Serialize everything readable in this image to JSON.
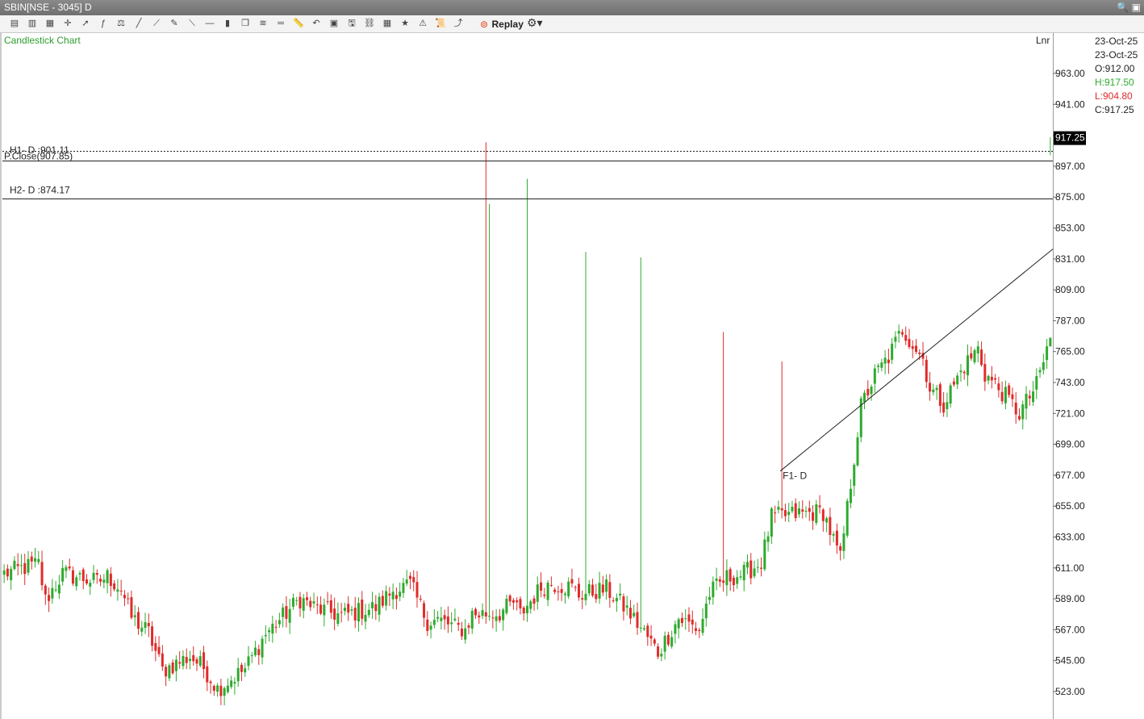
{
  "window": {
    "title": "SBIN[NSE - 3045] D"
  },
  "toolbar": {
    "icons": [
      "chart-type-icon",
      "bar-chart-icon",
      "candle-chart-icon",
      "crosshair-icon",
      "pointer-icon",
      "indicator-icon",
      "compare-icon",
      "line-tool-icon",
      "ray-icon",
      "pencil-icon",
      "trendline-icon",
      "horizontal-line-icon",
      "volume-icon",
      "cube-icon",
      "fibonacci-icon",
      "parallel-lines-icon",
      "ruler-icon",
      "undo-icon",
      "template-icon",
      "save-icon",
      "link-icon",
      "layout-icon",
      "star-icon",
      "alert-icon",
      "script-icon",
      "compare-line-icon"
    ],
    "replay_label": "Replay"
  },
  "chart": {
    "label": "Candlestick Chart",
    "scale_mode": "Lnr",
    "colors": {
      "up": "#2eaa2e",
      "down": "#e02b2b"
    }
  },
  "ohlc": {
    "date1": "23-Oct-25",
    "date2": "23-Oct-25",
    "open": "O:912.00",
    "high": "H:917.50",
    "low": "L:904.80",
    "close": "C:917.25",
    "colors": {
      "high": "#2eaa2e",
      "low": "#e02b2b"
    }
  },
  "last_price": "917.25",
  "levels": {
    "h1": {
      "label": "H1- D :901.11",
      "value": 901.11
    },
    "pclose": {
      "label": "P.Close(907.85)",
      "value": 907.85
    },
    "h2": {
      "label": "H2- D :874.17",
      "value": 874.17
    }
  },
  "trendline": {
    "label": "F1- D",
    "start_value": 680,
    "end_value": 838
  },
  "chart_data": {
    "type": "candlestick",
    "title": "",
    "y_ticks": [
      "963.00",
      "941.00",
      "919.00",
      "897.00",
      "875.00",
      "853.00",
      "831.00",
      "809.00",
      "787.00",
      "765.00",
      "743.00",
      "721.00",
      "699.00",
      "677.00",
      "655.00",
      "633.00",
      "611.00",
      "589.00",
      "567.00",
      "545.00",
      "523.00"
    ],
    "ylim": [
      505,
      990
    ],
    "n_bars": 305,
    "keypoints": [
      [
        0,
        607
      ],
      [
        7,
        612
      ],
      [
        10,
        614
      ],
      [
        12,
        588
      ],
      [
        17,
        607
      ],
      [
        24,
        603
      ],
      [
        27,
        601
      ],
      [
        30,
        605
      ],
      [
        34,
        596
      ],
      [
        37,
        576
      ],
      [
        42,
        565
      ],
      [
        46,
        538
      ],
      [
        50,
        543
      ],
      [
        54,
        548
      ],
      [
        58,
        540
      ],
      [
        62,
        525
      ],
      [
        70,
        539
      ],
      [
        76,
        564
      ],
      [
        86,
        589
      ],
      [
        90,
        583
      ],
      [
        98,
        577
      ],
      [
        108,
        583
      ],
      [
        113,
        595
      ],
      [
        118,
        599
      ],
      [
        123,
        573
      ],
      [
        126,
        574
      ],
      [
        132,
        568
      ],
      [
        134,
        567
      ],
      [
        136,
        578
      ],
      [
        144,
        579
      ],
      [
        148,
        586
      ],
      [
        150,
        578
      ],
      [
        156,
        597
      ],
      [
        159,
        600
      ],
      [
        165,
        597
      ],
      [
        167,
        592
      ],
      [
        175,
        596
      ],
      [
        181,
        581
      ],
      [
        186,
        565
      ],
      [
        190,
        551
      ],
      [
        196,
        575
      ],
      [
        202,
        567
      ],
      [
        205,
        593
      ],
      [
        210,
        604
      ],
      [
        215,
        607
      ],
      [
        220,
        615
      ],
      [
        223,
        647
      ],
      [
        229,
        649
      ],
      [
        238,
        651
      ],
      [
        243,
        617
      ],
      [
        249,
        726
      ],
      [
        253,
        748
      ],
      [
        257,
        761
      ],
      [
        261,
        781
      ],
      [
        267,
        760
      ],
      [
        269,
        739
      ],
      [
        273,
        728
      ],
      [
        279,
        755
      ],
      [
        283,
        767
      ],
      [
        285,
        749
      ],
      [
        290,
        736
      ],
      [
        295,
        721
      ],
      [
        300,
        741
      ],
      [
        308,
        808
      ],
      [
        314,
        822
      ],
      [
        318,
        821
      ],
      [
        322,
        826
      ],
      [
        325,
        824
      ],
      [
        329,
        838
      ],
      [
        334,
        829
      ],
      [
        337,
        873
      ],
      [
        343,
        843
      ],
      [
        348,
        844
      ],
      [
        350,
        860
      ],
      [
        356,
        839
      ],
      [
        360,
        825
      ],
      [
        364,
        829
      ],
      [
        369,
        792
      ],
      [
        376,
        800
      ],
      [
        382,
        807
      ],
      [
        387,
        789
      ],
      [
        391,
        791
      ],
      [
        398,
        797
      ],
      [
        405,
        802
      ],
      [
        413,
        785
      ],
      [
        418,
        802
      ],
      [
        424,
        818
      ],
      [
        430,
        815
      ],
      [
        435,
        843
      ],
      [
        441,
        826
      ],
      [
        445,
        827
      ],
      [
        449,
        837
      ],
      [
        455,
        870
      ],
      [
        459,
        866
      ],
      [
        463,
        845
      ],
      [
        467,
        834
      ],
      [
        473,
        816
      ],
      [
        476,
        775
      ],
      [
        480,
        758
      ],
      [
        483,
        765
      ],
      [
        487,
        740
      ],
      [
        490,
        720
      ],
      [
        494,
        726
      ],
      [
        497,
        717
      ],
      [
        500,
        688
      ],
      [
        504,
        722
      ],
      [
        510,
        733
      ],
      [
        513,
        764
      ],
      [
        518,
        761
      ],
      [
        522,
        770
      ],
      [
        527,
        748
      ],
      [
        533,
        776
      ],
      [
        537,
        787
      ],
      [
        540,
        817
      ],
      [
        545,
        810
      ],
      [
        548,
        804
      ],
      [
        553,
        789
      ],
      [
        558,
        794
      ],
      [
        563,
        811
      ],
      [
        567,
        800
      ],
      [
        575,
        803
      ],
      [
        580,
        812
      ],
      [
        585,
        809
      ],
      [
        589,
        811
      ],
      [
        594,
        801
      ],
      [
        598,
        817
      ],
      [
        605,
        830
      ],
      [
        608,
        824
      ],
      [
        612,
        842
      ],
      [
        618,
        848
      ],
      [
        624,
        853
      ],
      [
        627,
        851
      ],
      [
        631,
        856
      ],
      [
        634,
        869
      ],
      [
        638,
        861
      ],
      [
        641,
        874
      ],
      [
        645,
        876
      ],
      [
        649,
        864
      ],
      [
        652,
        873
      ],
      [
        659,
        868
      ],
      [
        665,
        879
      ],
      [
        668,
        885
      ],
      [
        672,
        903
      ],
      [
        674,
        916
      ]
    ],
    "spikes": [
      [
        140,
        914,
        730
      ],
      [
        141,
        870,
        860
      ],
      [
        152,
        888,
        880
      ],
      [
        185,
        832,
        762
      ],
      [
        169,
        836,
        778
      ],
      [
        209,
        779,
        723
      ],
      [
        226,
        758,
        680
      ]
    ]
  }
}
